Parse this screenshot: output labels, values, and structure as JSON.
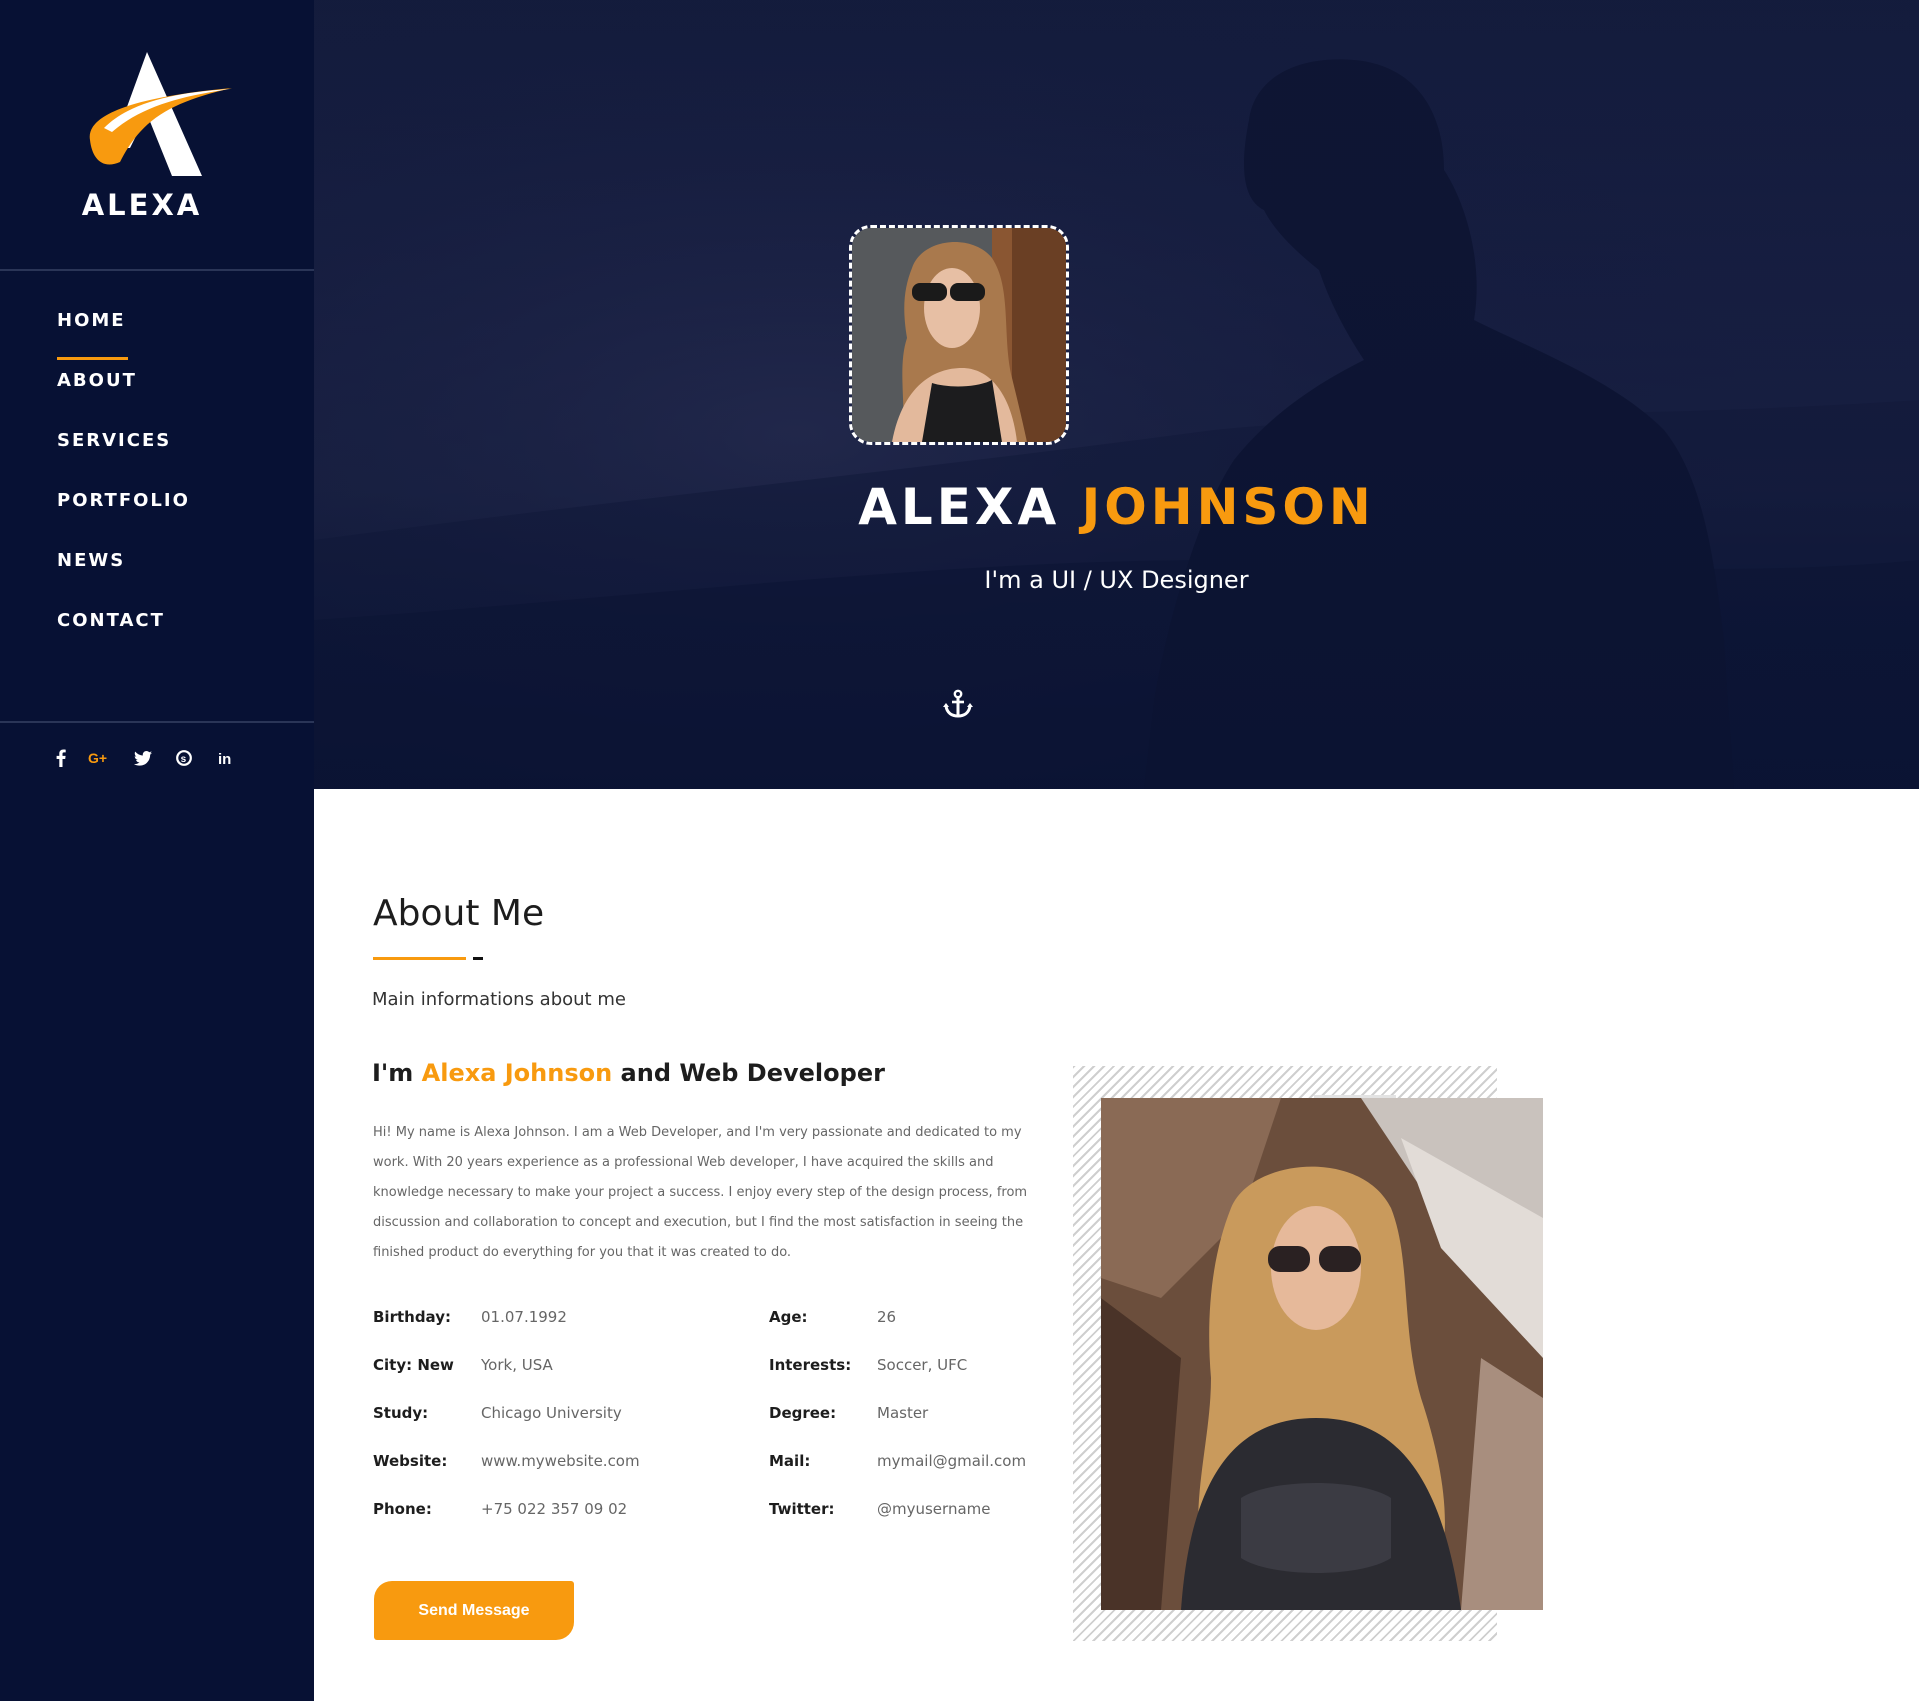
{
  "brand": {
    "name": "ALEXA"
  },
  "nav": {
    "items": [
      {
        "label": "HOME",
        "active": true
      },
      {
        "label": "ABOUT",
        "active": false
      },
      {
        "label": "SERVICES",
        "active": false
      },
      {
        "label": "PORTFOLIO",
        "active": false
      },
      {
        "label": "NEWS",
        "active": false
      },
      {
        "label": "CONTACT",
        "active": false
      }
    ]
  },
  "social": [
    {
      "icon": "facebook-icon",
      "glyph": "f"
    },
    {
      "icon": "google-plus-icon",
      "glyph": "G+"
    },
    {
      "icon": "twitter-icon",
      "glyph": "t"
    },
    {
      "icon": "skype-icon",
      "glyph": "S"
    },
    {
      "icon": "linkedin-icon",
      "glyph": "in"
    }
  ],
  "hero": {
    "first_name": "ALEXA",
    "last_name": "JOHNSON",
    "subtitle": "I'm a UI / UX Designer"
  },
  "about": {
    "title": "About Me",
    "subtitle": "Main informations about me",
    "intro_prefix": "I'm ",
    "intro_name": "Alexa Johnson",
    "intro_suffix": " and Web Developer",
    "bio": "Hi! My name is Alexa Johnson. I am a Web Developer, and I'm very passionate and dedicated to my work. With 20 years experience as a professional Web developer, I have acquired the skills and knowledge necessary to make your project a success. I enjoy every step of the design process, from discussion and collaboration to concept and execution, but I find the most satisfaction in seeing the finished product do everything for you that it was created to do.",
    "info": {
      "birthday_label": "Birthday:",
      "birthday_value": "01.07.1992",
      "age_label": "Age:",
      "age_value": "26",
      "city_label": "City: New",
      "city_value": "York, USA",
      "interests_label": "Interests:",
      "interests_value": "Soccer, UFC",
      "study_label": "Study:",
      "study_value": "Chicago University",
      "degree_label": "Degree:",
      "degree_value": "Master",
      "website_label": "Website:",
      "website_value": "www.mywebsite.com",
      "mail_label": "Mail:",
      "mail_value": "mymail@gmail.com",
      "phone_label": "Phone:",
      "phone_value": "+75 022 357 09 02",
      "twitter_label": "Twitter:",
      "twitter_value": "@myusername"
    },
    "button": "Send Message"
  },
  "colors": {
    "accent": "#f89a0f",
    "sidebar": "#071134",
    "hero": "#1a2145"
  }
}
